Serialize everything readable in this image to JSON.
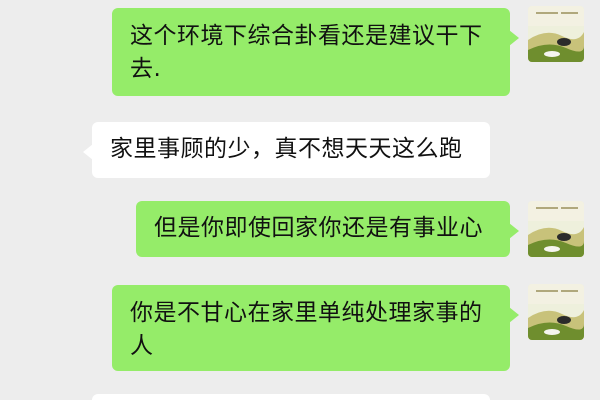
{
  "conversation": {
    "messages": [
      {
        "side": "sent",
        "text": "这个环境下综合卦看还是建议干下去."
      },
      {
        "side": "received",
        "text": "家里事顾的少，真不想天天这么跑"
      },
      {
        "side": "sent",
        "text": "但是你即使回家你还是有事业心"
      },
      {
        "side": "sent",
        "text": "你是不甘心在家里单纯处理家事的人"
      },
      {
        "side": "received",
        "text": ""
      }
    ]
  },
  "avatar": {
    "icon": "landscape-avatar-icon",
    "colors": {
      "sky": "#eef0dc",
      "hill": "#6f8e2e",
      "accent": "#c8c27a",
      "stone": "#2b2b2b"
    }
  },
  "colors": {
    "background": "#ededed",
    "sent_bubble": "#95ec69",
    "received_bubble": "#ffffff",
    "text": "#111111"
  }
}
